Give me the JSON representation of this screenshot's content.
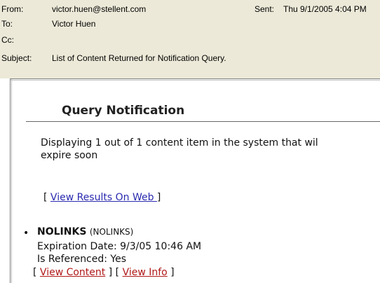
{
  "header": {
    "from_label": "From:",
    "from_value": "victor.huen@stellent.com",
    "sent_label": "Sent:",
    "sent_value": "Thu 9/1/2005 4:04 PM",
    "to_label": "To:",
    "to_value": "Victor Huen",
    "cc_label": "Cc:",
    "cc_value": "",
    "subject_label": "Subject:",
    "subject_value": "List of Content Returned for Notification Query."
  },
  "body": {
    "title": "Query Notification",
    "description_line1": "Displaying 1 out of 1 content item in the system that wil",
    "description_line2": "expire soon",
    "view_results_link": "View Results On Web ",
    "item": {
      "name": "NOLINKS",
      "id": "(NOLINKS)",
      "expiration": "Expiration Date: 9/3/05 10:46 AM",
      "referenced": "Is Referenced: Yes",
      "view_content_link": "View Content",
      "view_info_link": "View Info"
    }
  }
}
